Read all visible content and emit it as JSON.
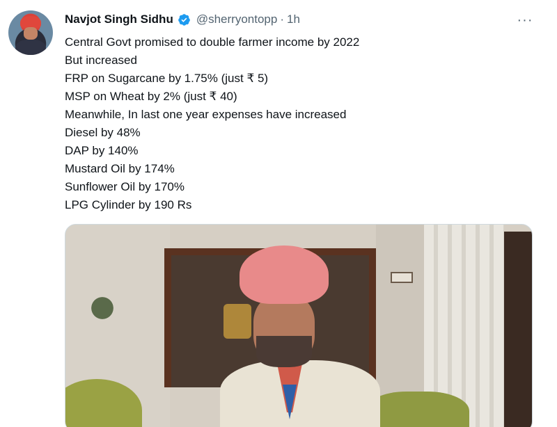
{
  "author": {
    "name": "Navjot Singh Sidhu",
    "handle": "@sherryontopp",
    "separator": "·",
    "time": "1h",
    "avatar_icon": "profile-photo"
  },
  "menu": {
    "more_label": "···"
  },
  "tweet": {
    "lines": [
      "Central Govt promised to double farmer income by 2022",
      "But increased",
      "FRP on Sugarcane by 1.75% (just ₹ 5)",
      "MSP on Wheat by 2% (just ₹ 40)",
      "Meanwhile, In last one year expenses have increased",
      "Diesel by 48%",
      "DAP by 140%",
      "Mustard Oil by 174%",
      "Sunflower Oil by 170%",
      "LPG Cylinder by 190 Rs"
    ]
  },
  "colors": {
    "verified": "#1d9bf0",
    "secondary_text": "#536471",
    "border": "#cfd9de"
  }
}
